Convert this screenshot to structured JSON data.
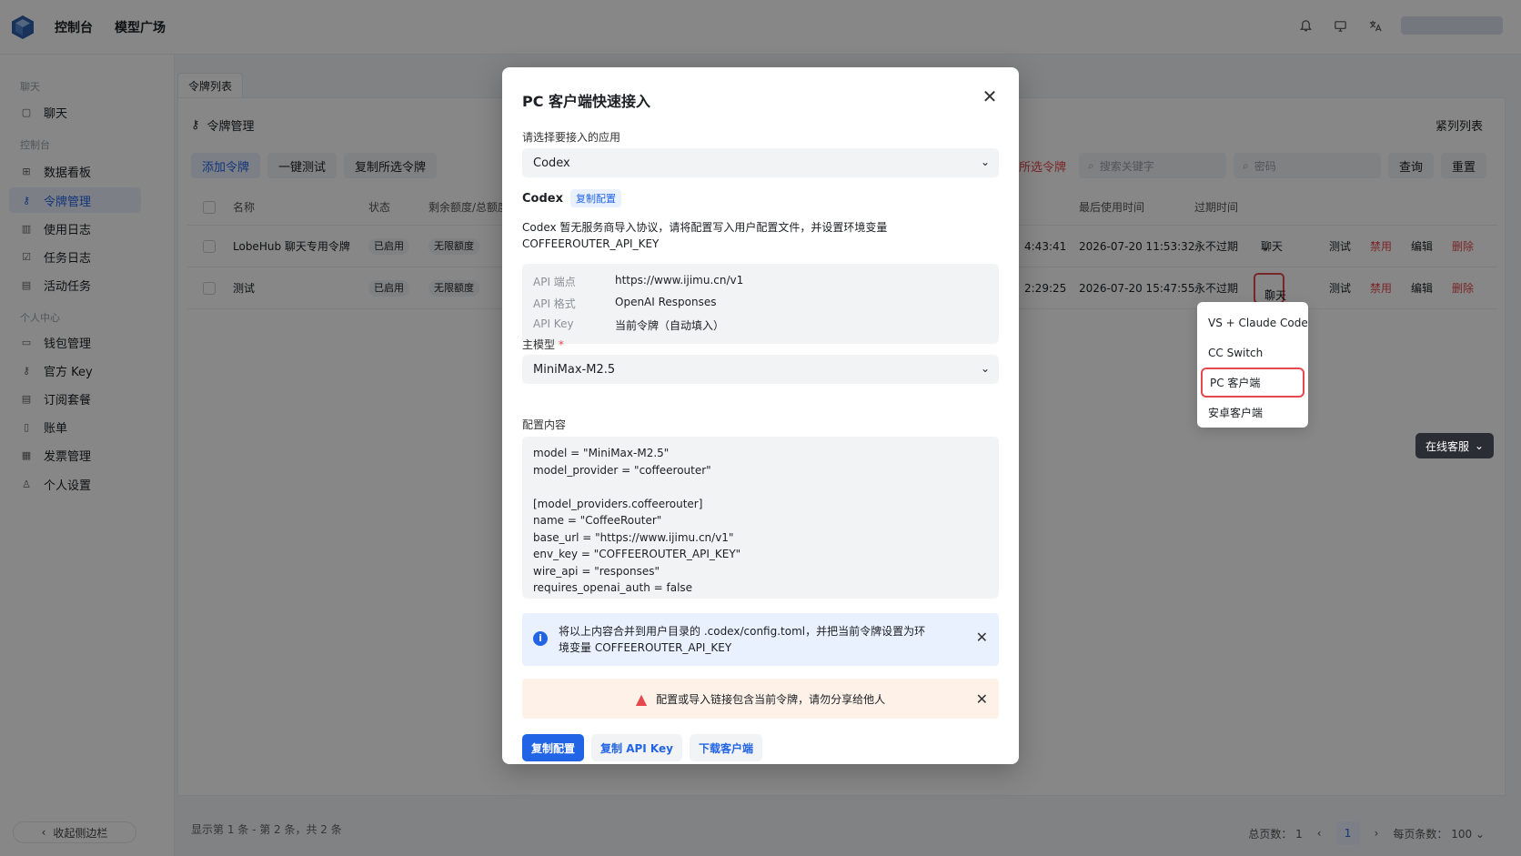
{
  "topbar": {
    "nav": [
      "控制台",
      "模型广场"
    ]
  },
  "sidebar": {
    "groups": [
      "聊天",
      "控制台",
      "个人中心"
    ],
    "items": [
      "聊天",
      "数据看板",
      "令牌管理",
      "使用日志",
      "任务日志",
      "活动任务",
      "钱包管理",
      "官方 Key",
      "订阅套餐",
      "账单",
      "发票管理",
      "个人设置"
    ],
    "collapse": "收起侧边栏"
  },
  "main": {
    "tab": "令牌列表",
    "title": "令牌管理",
    "compact": "紧列列表",
    "buttons": [
      "添加令牌",
      "一键测试",
      "复制所选令牌"
    ],
    "delete_selected": "删除所选令牌",
    "search_placeholder": "搜索关键字",
    "key_placeholder": "密码",
    "query": "查询",
    "reset": "重置",
    "headers": {
      "name": "名称",
      "status": "状态",
      "quota": "剩余额度/总额度",
      "last_used": "最后使用时间",
      "expire": "过期时间"
    },
    "rows": [
      {
        "name": "LobeHub 聊天专用令牌",
        "status": "已启用",
        "quota": "无限额度",
        "created": "4:43:41",
        "last_used": "2026-07-20 11:53:32",
        "expire": "永不过期"
      },
      {
        "name": "测试",
        "status": "已启用",
        "quota": "无限额度",
        "created": "2:29:25",
        "last_used": "2026-07-20 15:47:55",
        "expire": "永不过期"
      }
    ],
    "row_actions": {
      "chat": "聊天",
      "test": "测试",
      "disable": "禁用",
      "edit": "编辑",
      "delete": "删除"
    },
    "footer": "显示第 1 条 - 第 2 条，共 2 条",
    "pager": {
      "total": "总页数： 1",
      "page": "1",
      "per_page": "每页条数： 100"
    }
  },
  "dropdown": {
    "items": [
      "VS + Claude Code",
      "CC Switch",
      "PC 客户端",
      "安卓客户端"
    ]
  },
  "kefu": "在线客服",
  "modal": {
    "title": "PC 客户端快速接入",
    "app_label": "请选择要接入的应用",
    "app_value": "Codex",
    "codex_label": "Codex",
    "copy_tag": "复制配置",
    "desc": "Codex 暂无服务商导入协议，请将配置写入用户配置文件，并设置环境变量 COFFEEROUTER_API_KEY",
    "info": [
      {
        "k": "API 端点",
        "v": "https://www.ijimu.cn/v1"
      },
      {
        "k": "API 格式",
        "v": "OpenAI Responses"
      },
      {
        "k": "API Key",
        "v": "当前令牌（自动填入）"
      }
    ],
    "model_label": "主模型",
    "required": "*",
    "model_value": "MiniMax-M2.5",
    "config_label": "配置内容",
    "config": "model = \"MiniMax-M2.5\"\nmodel_provider = \"coffeerouter\"\n\n[model_providers.coffeerouter]\nname = \"CoffeeRouter\"\nbase_url = \"https://www.ijimu.cn/v1\"\nenv_key = \"COFFEEROUTER_API_KEY\"\nwire_api = \"responses\"\nrequires_openai_auth = false",
    "alert_info": "将以上内容合并到用户目录的 .codex/config.toml，并把当前令牌设置为环境变量 COFFEEROUTER_API_KEY",
    "alert_warn": "配置或导入链接包含当前令牌，请勿分享给他人",
    "buttons": [
      "复制配置",
      "复制 API Key",
      "下载客户端"
    ]
  },
  "colors": {
    "accent": "#2264e6",
    "danger": "#e5484d",
    "warn_bg": "#fdf1e8",
    "info_bg": "#eaf1fe"
  }
}
